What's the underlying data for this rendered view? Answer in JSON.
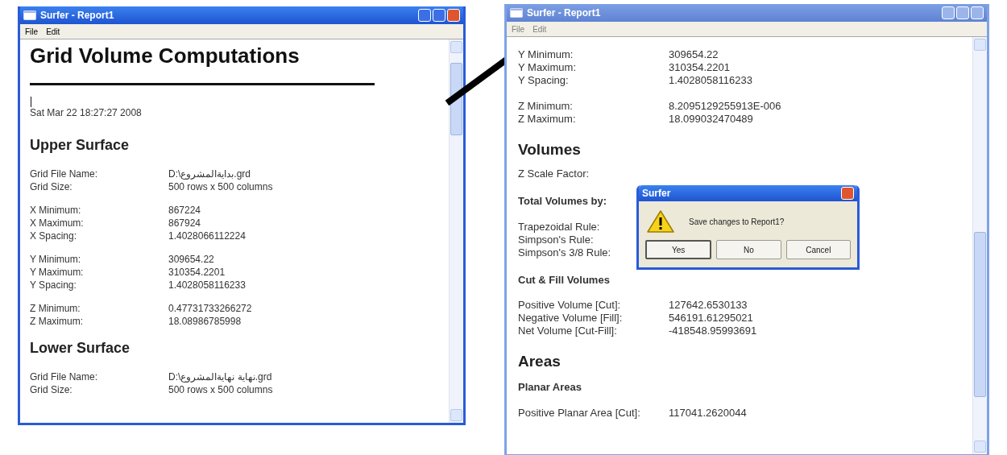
{
  "windows": [
    {
      "title": "Surfer - Report1",
      "active": true,
      "menu": [
        {
          "label": "File",
          "disabled": false
        },
        {
          "label": "Edit",
          "disabled": false
        }
      ],
      "blocks": [
        {
          "kind": "h1",
          "text": "Grid Volume Computations"
        },
        {
          "kind": "rule"
        },
        {
          "kind": "cursor"
        },
        {
          "kind": "text",
          "text": "Sat Mar 22 18:27:27 2008"
        },
        {
          "kind": "h2",
          "text": "Upper Surface"
        },
        {
          "kind": "fields",
          "rows": [
            {
              "label": "Grid File Name:",
              "value": "D:\\بدايةالمشروع.grd"
            },
            {
              "label": "Grid Size:",
              "value": "500 rows x 500 columns"
            }
          ]
        },
        {
          "kind": "fields",
          "rows": [
            {
              "label": "X Minimum:",
              "value": "867224"
            },
            {
              "label": "X Maximum:",
              "value": "867924"
            },
            {
              "label": "X Spacing:",
              "value": "1.4028066112224"
            }
          ]
        },
        {
          "kind": "fields",
          "rows": [
            {
              "label": "Y Minimum:",
              "value": "309654.22"
            },
            {
              "label": "Y Maximum:",
              "value": "310354.2201"
            },
            {
              "label": "Y Spacing:",
              "value": "1.4028058116233"
            }
          ]
        },
        {
          "kind": "fields",
          "rows": [
            {
              "label": "Z Minimum:",
              "value": "0.47731733266272"
            },
            {
              "label": "Z Maximum:",
              "value": "18.08986785998"
            }
          ]
        },
        {
          "kind": "h2",
          "text": "Lower Surface"
        },
        {
          "kind": "fields",
          "rows": [
            {
              "label": "Grid File Name:",
              "value": "D:\\نهاية نهايةالمشروع.grd"
            },
            {
              "label": "Grid Size:",
              "value": "500 rows x 500 columns"
            }
          ]
        }
      ]
    },
    {
      "title": "Surfer - Report1",
      "active": false,
      "menu": [
        {
          "label": "File",
          "disabled": true
        },
        {
          "label": "Edit",
          "disabled": true
        }
      ],
      "blocks": [
        {
          "kind": "fields",
          "rows": [
            {
              "label": "Y Minimum:",
              "value": "309654.22"
            },
            {
              "label": "Y Maximum:",
              "value": "310354.2201"
            },
            {
              "label": "Y Spacing:",
              "value": "1.4028058116233"
            }
          ]
        },
        {
          "kind": "fields",
          "rows": [
            {
              "label": "Z Minimum:",
              "value": "8.2095129255913E-006"
            },
            {
              "label": "Z Maximum:",
              "value": "18.099032470489"
            }
          ]
        },
        {
          "kind": "h2",
          "text": "Volumes"
        },
        {
          "kind": "fields",
          "rows": [
            {
              "label": "Z Scale Factor:"
            }
          ]
        },
        {
          "kind": "h3",
          "text": "Total Volumes by:"
        },
        {
          "kind": "fields",
          "rows": [
            {
              "label": "Trapezoidal Rule:"
            },
            {
              "label": "Simpson's Rule:"
            },
            {
              "label": "Simpson's 3/8 Rule:"
            }
          ]
        },
        {
          "kind": "h3",
          "text": "Cut & Fill Volumes"
        },
        {
          "kind": "fields",
          "rows": [
            {
              "label": "Positive Volume [Cut]:",
              "value": "127642.6530133"
            },
            {
              "label": "Negative Volume [Fill]:",
              "value": "546191.61295021"
            },
            {
              "label": "Net Volume [Cut-Fill]:",
              "value": "-418548.95993691"
            }
          ]
        },
        {
          "kind": "h2",
          "text": "Areas"
        },
        {
          "kind": "h3",
          "text": "Planar Areas"
        },
        {
          "kind": "fields",
          "rows": [
            {
              "label": "Positive Planar Area [Cut]:",
              "value": "117041.2620044"
            }
          ]
        }
      ]
    }
  ],
  "dialog": {
    "title": "Surfer",
    "message": "Save changes to Report1?",
    "buttons": [
      {
        "label": "Yes",
        "default": true
      },
      {
        "label": "No",
        "default": false
      },
      {
        "label": "Cancel",
        "default": false
      }
    ]
  }
}
